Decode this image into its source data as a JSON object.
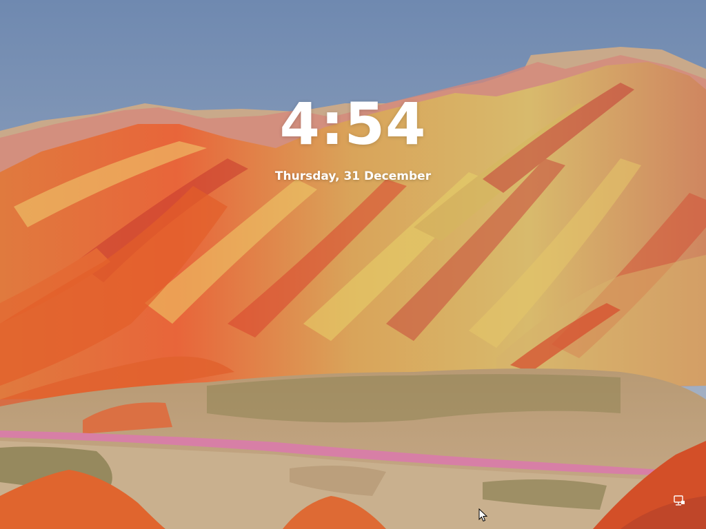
{
  "lock_screen": {
    "time": "4:54",
    "date": "Thursday, 31 December"
  },
  "status": {
    "network_icon": "network-wired-icon",
    "pointer_icon": "mouse-pointer-icon"
  },
  "colors": {
    "sky_top": "#7d94b8",
    "sky_bottom": "#aeb8c6",
    "accent_red": "#e2582a",
    "accent_yellow": "#d8c35a",
    "road": "#d37da3",
    "text": "#ffffff"
  }
}
